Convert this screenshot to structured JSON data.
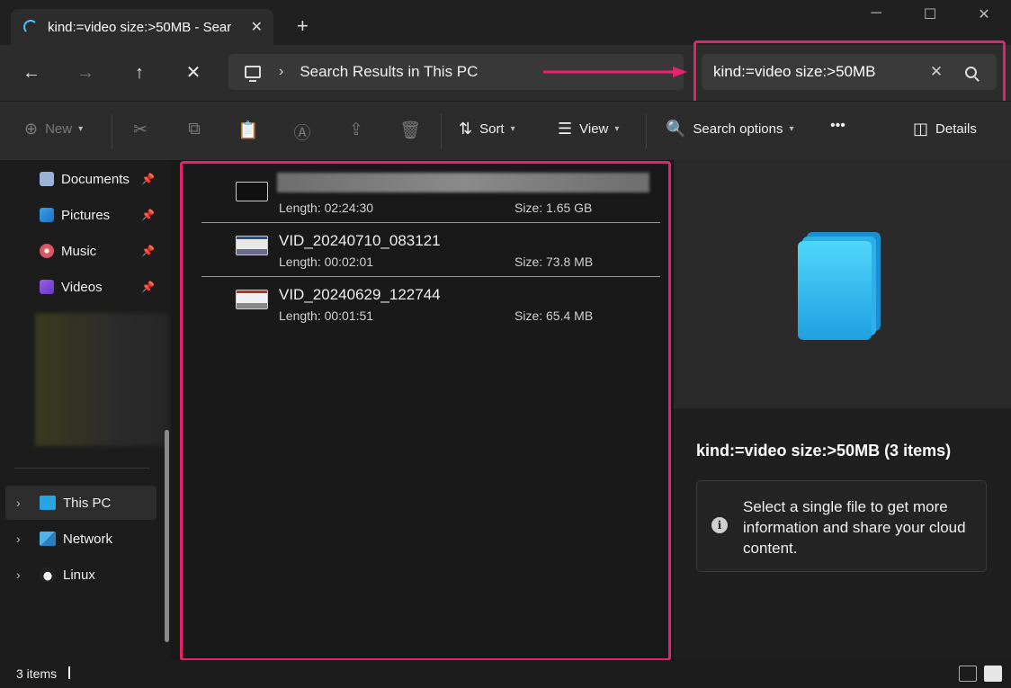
{
  "window": {
    "tab_title": "kind:=video size:>50MB - Sear",
    "tab_close": "✕",
    "new_tab": "+",
    "minimize": "─",
    "maximize": "☐",
    "close": "✕"
  },
  "nav": {
    "back": "←",
    "forward": "→",
    "up": "↑",
    "stop": "✕"
  },
  "address": {
    "chevron": "›",
    "location": "Search Results in This PC"
  },
  "search": {
    "query": "kind:=video size:>50MB",
    "clear": "✕"
  },
  "toolbar": {
    "new_label": "New",
    "sort_label": "Sort",
    "view_label": "View",
    "search_options_label": "Search options",
    "more_label": "•••",
    "details_label": "Details"
  },
  "sidebar": {
    "quick_access": [
      {
        "label": "Documents",
        "icon": "documents-icon"
      },
      {
        "label": "Pictures",
        "icon": "pictures-icon"
      },
      {
        "label": "Music",
        "icon": "music-icon"
      },
      {
        "label": "Videos",
        "icon": "videos-icon"
      }
    ],
    "locations": [
      {
        "label": "This PC",
        "icon": "this-pc-icon",
        "selected": true
      },
      {
        "label": "Network",
        "icon": "network-icon"
      },
      {
        "label": "Linux",
        "icon": "linux-icon"
      }
    ]
  },
  "files": [
    {
      "name": "",
      "length_label": "Length: 02:24:30",
      "size_label": "Size: 1.65 GB",
      "name_obscured": true
    },
    {
      "name": "VID_20240710_083121",
      "length_label": "Length: 00:02:01",
      "size_label": "Size: 73.8 MB"
    },
    {
      "name": "VID_20240629_122744",
      "length_label": "Length: 00:01:51",
      "size_label": "Size: 65.4 MB"
    }
  ],
  "details_pane": {
    "title": "kind:=video size:>50MB (3 items)",
    "info_text": "Select a single file to get more information and share your cloud content."
  },
  "status": {
    "item_count": "3 items"
  },
  "colors": {
    "highlight": "#e6226e",
    "accent": "#4cc2ff",
    "background": "#191919"
  }
}
